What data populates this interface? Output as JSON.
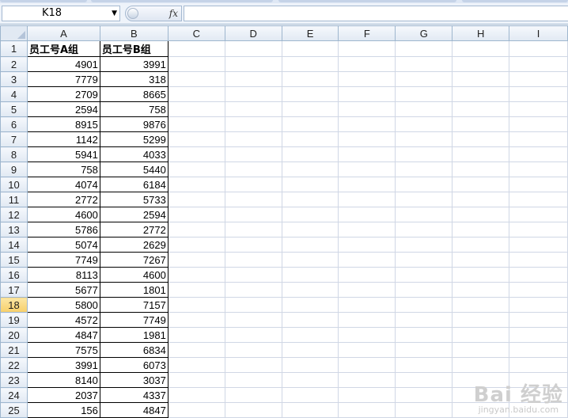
{
  "formula_bar": {
    "name_box": "K18",
    "fx_label": "fx",
    "formula": ""
  },
  "columns": [
    "A",
    "B",
    "C",
    "D",
    "E",
    "F",
    "G",
    "H",
    "I"
  ],
  "rows": [
    {
      "n": "1",
      "a": "员工号A组",
      "b": "员工号B组"
    },
    {
      "n": "2",
      "a": "4901",
      "b": "3991"
    },
    {
      "n": "3",
      "a": "7779",
      "b": "318"
    },
    {
      "n": "4",
      "a": "2709",
      "b": "8665"
    },
    {
      "n": "5",
      "a": "2594",
      "b": "758"
    },
    {
      "n": "6",
      "a": "8915",
      "b": "9876"
    },
    {
      "n": "7",
      "a": "1142",
      "b": "5299"
    },
    {
      "n": "8",
      "a": "5941",
      "b": "4033"
    },
    {
      "n": "9",
      "a": "758",
      "b": "5440"
    },
    {
      "n": "10",
      "a": "4074",
      "b": "6184"
    },
    {
      "n": "11",
      "a": "2772",
      "b": "5733"
    },
    {
      "n": "12",
      "a": "4600",
      "b": "2594"
    },
    {
      "n": "13",
      "a": "5786",
      "b": "2772"
    },
    {
      "n": "14",
      "a": "5074",
      "b": "2629"
    },
    {
      "n": "15",
      "a": "7749",
      "b": "7267"
    },
    {
      "n": "16",
      "a": "8113",
      "b": "4600"
    },
    {
      "n": "17",
      "a": "5677",
      "b": "1801"
    },
    {
      "n": "18",
      "a": "5800",
      "b": "7157"
    },
    {
      "n": "19",
      "a": "4572",
      "b": "7749"
    },
    {
      "n": "20",
      "a": "4847",
      "b": "1981"
    },
    {
      "n": "21",
      "a": "7575",
      "b": "6834"
    },
    {
      "n": "22",
      "a": "3991",
      "b": "6073"
    },
    {
      "n": "23",
      "a": "8140",
      "b": "3037"
    },
    {
      "n": "24",
      "a": "2037",
      "b": "4337"
    },
    {
      "n": "25",
      "a": "156",
      "b": "4847"
    }
  ],
  "active_row": "18",
  "watermark": {
    "main": "Bai 经验",
    "sub": "jingyan.baidu.com"
  },
  "colors": {
    "header_bg": "#e1e9f3",
    "gridline": "#d0d7e5",
    "active_row_header": "#f7cf6a"
  }
}
